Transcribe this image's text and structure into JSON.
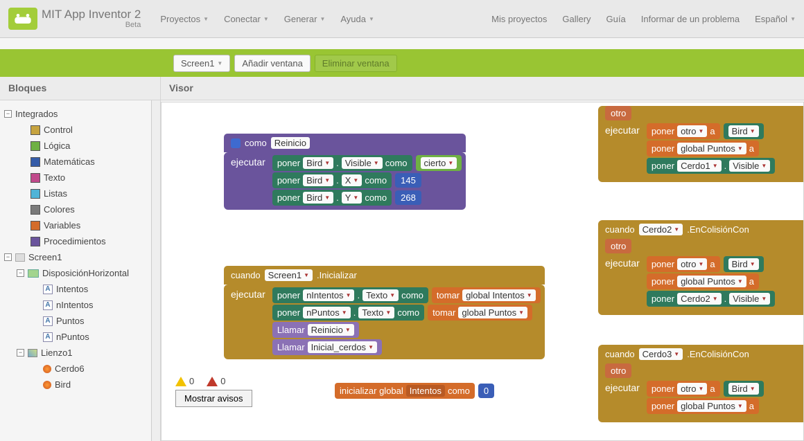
{
  "brand": {
    "title": "MIT App Inventor 2",
    "beta": "Beta"
  },
  "topnav_left": [
    "Proyectos",
    "Conectar",
    "Generar",
    "Ayuda"
  ],
  "topnav_right": [
    "Mis proyectos",
    "Gallery",
    "Guía",
    "Informar de un problema",
    "Español"
  ],
  "greenrow": {
    "screen_dd": "Screen1",
    "add_win": "Añadir ventana",
    "del_win": "Eliminar ventana"
  },
  "colheads": {
    "left": "Bloques",
    "right": "Visor"
  },
  "tree": {
    "integrados": "Integrados",
    "categories": [
      {
        "color": "#c6a33f",
        "label": "Control"
      },
      {
        "color": "#6fb143",
        "label": "Lógica"
      },
      {
        "color": "#355ca8",
        "label": "Matemáticas"
      },
      {
        "color": "#c04a8b",
        "label": "Texto"
      },
      {
        "color": "#4fb4d7",
        "label": "Listas"
      },
      {
        "color": "#7a7a7a",
        "label": "Colores"
      },
      {
        "color": "#d46c2a",
        "label": "Variables"
      },
      {
        "color": "#6a549c",
        "label": "Procedimientos"
      }
    ],
    "screen1": "Screen1",
    "hdisp": "DisposiciónHorizontal",
    "labels": [
      "Intentos",
      "nIntentos",
      "Puntos",
      "nPuntos"
    ],
    "lienzo": "Lienzo1",
    "sprites": [
      "Cerdo6",
      "Bird"
    ]
  },
  "blocks": {
    "reinicio": {
      "como": "como",
      "name": "Reinicio",
      "ejecutar": "ejecutar",
      "rows": [
        {
          "poner": "poner",
          "obj": "Bird",
          "dot": ".",
          "prop": "Visible",
          "como": "como",
          "val_type": "bool",
          "val": "cierto"
        },
        {
          "poner": "poner",
          "obj": "Bird",
          "dot": ".",
          "prop": "X",
          "como": "como",
          "val_type": "num",
          "val": "145"
        },
        {
          "poner": "poner",
          "obj": "Bird",
          "dot": ".",
          "prop": "Y",
          "como": "como",
          "val_type": "num",
          "val": "268"
        }
      ]
    },
    "screen_init": {
      "cuando": "cuando",
      "obj": "Screen1",
      "evt": ".Inicializar",
      "ejecutar": "ejecutar",
      "rows": [
        {
          "poner": "poner",
          "obj": "nIntentos",
          "dot": ".",
          "prop": "Texto",
          "como": "como",
          "tomar": "tomar",
          "var": "global Intentos"
        },
        {
          "poner": "poner",
          "obj": "nPuntos",
          "dot": ".",
          "prop": "Texto",
          "como": "como",
          "tomar": "tomar",
          "var": "global Puntos"
        }
      ],
      "calls": [
        {
          "llamar": "Llamar",
          "proc": "Reinicio"
        },
        {
          "llamar": "Llamar",
          "proc": "Inicial_cerdos"
        }
      ]
    },
    "global_init": {
      "label": "inicializar global",
      "name": "Intentos",
      "como": "como",
      "val": "0"
    },
    "col_top": {
      "otro": "otro",
      "ejecutar": "ejecutar",
      "rows": [
        {
          "poner": "poner",
          "var": "otro",
          "a": "a",
          "val": "Bird"
        },
        {
          "poner": "poner",
          "var": "global Puntos",
          "a": "a"
        },
        {
          "poner": "poner",
          "obj": "Cerdo1",
          "dot": ".",
          "prop": "Visible"
        }
      ]
    },
    "col_cerdo2": {
      "cuando": "cuando",
      "obj": "Cerdo2",
      "evt": ".EnColisiónCon",
      "otro": "otro",
      "ejecutar": "ejecutar",
      "rows": [
        {
          "poner": "poner",
          "var": "otro",
          "a": "a",
          "val": "Bird"
        },
        {
          "poner": "poner",
          "var": "global Puntos",
          "a": "a"
        },
        {
          "poner": "poner",
          "obj": "Cerdo2",
          "dot": ".",
          "prop": "Visible"
        }
      ]
    },
    "col_cerdo3": {
      "cuando": "cuando",
      "obj": "Cerdo3",
      "evt": ".EnColisiónCon",
      "otro": "otro",
      "ejecutar": "ejecutar",
      "rows": [
        {
          "poner": "poner",
          "var": "otro",
          "a": "a",
          "val": "Bird"
        },
        {
          "poner": "poner",
          "var": "global Puntos",
          "a": "a"
        }
      ]
    }
  },
  "status": {
    "warn": "0",
    "err": "0",
    "mostrar": "Mostrar avisos"
  }
}
